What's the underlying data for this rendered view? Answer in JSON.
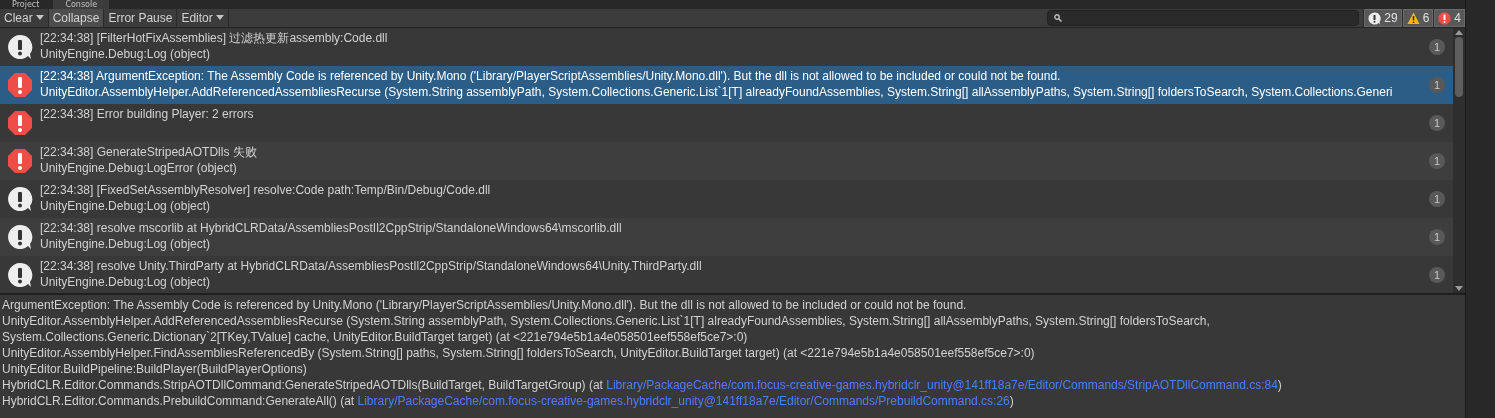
{
  "tabs": [
    {
      "label": "Project",
      "selected": false
    },
    {
      "label": "Console",
      "selected": true
    }
  ],
  "toolbar": {
    "buttons": [
      {
        "label": "Clear",
        "dropdown": true,
        "on": false
      },
      {
        "label": "Collapse",
        "dropdown": false,
        "on": true
      },
      {
        "label": "Error Pause",
        "dropdown": false,
        "on": false
      },
      {
        "label": "Editor",
        "dropdown": true,
        "on": false
      }
    ],
    "counters": [
      {
        "kind": "log",
        "count": "29",
        "selected": true
      },
      {
        "kind": "warning",
        "count": "6",
        "selected": true
      },
      {
        "kind": "error",
        "count": "4",
        "selected": true
      }
    ]
  },
  "entries": [
    {
      "kind": "log",
      "selected": false,
      "message": "[22:34:38] [FilterHotFixAssemblies] 过滤热更新assembly:Code.dll",
      "trace": "UnityEngine.Debug:Log (object)",
      "count": "1"
    },
    {
      "kind": "error",
      "selected": true,
      "message": "[22:34:38] ArgumentException: The Assembly Code is referenced by Unity.Mono ('Library/PlayerScriptAssemblies/Unity.Mono.dll'). But the dll is not allowed to be included or could not be found.",
      "trace": "UnityEditor.AssemblyHelper.AddReferencedAssembliesRecurse (System.String assemblyPath, System.Collections.Generic.List`1[T] alreadyFoundAssemblies, System.String[] allAssemblyPaths, System.String[] foldersToSearch, System.Collections.Generi",
      "count": "1"
    },
    {
      "kind": "error",
      "selected": false,
      "message": "[22:34:38] Error building Player: 2 errors",
      "count": "1"
    },
    {
      "kind": "error",
      "selected": false,
      "message": "[22:34:38] GenerateStripedAOTDlls 失败",
      "trace": "UnityEngine.Debug:LogError (object)",
      "count": "1"
    },
    {
      "kind": "log",
      "selected": false,
      "message": "[22:34:38] [FixedSetAssemblyResolver] resolve:Code path:Temp/Bin/Debug/Code.dll",
      "trace": "UnityEngine.Debug:Log (object)",
      "count": "1"
    },
    {
      "kind": "log",
      "selected": false,
      "message": "[22:34:38] resolve mscorlib at HybridCLRData/AssembliesPostIl2CppStrip/StandaloneWindows64\\mscorlib.dll",
      "trace": "UnityEngine.Debug:Log (object)",
      "count": "1"
    },
    {
      "kind": "log",
      "selected": false,
      "message": "[22:34:38] resolve Unity.ThirdParty at HybridCLRData/AssembliesPostIl2CppStrip/StandaloneWindows64\\Unity.ThirdParty.dll",
      "trace": "UnityEngine.Debug:Log (object)",
      "count": "1"
    }
  ],
  "details": [
    {
      "text": "ArgumentException: The Assembly Code is referenced by Unity.Mono ('Library/PlayerScriptAssemblies/Unity.Mono.dll'). But the dll is not allowed to be included or could not be found."
    },
    {
      "text": "UnityEditor.AssemblyHelper.AddReferencedAssembliesRecurse (System.String assemblyPath, System.Collections.Generic.List`1[T] alreadyFoundAssemblies, System.String[] allAssemblyPaths, System.String[] foldersToSearch,"
    },
    {
      "text": "System.Collections.Generic.Dictionary`2[TKey,TValue] cache, UnityEditor.BuildTarget target) (at <221e794e5b1a4e058501eef558ef5ce7>:0)"
    },
    {
      "text": "UnityEditor.AssemblyHelper.FindAssembliesReferencedBy (System.String[] paths, System.String[] foldersToSearch, UnityEditor.BuildTarget target) (at <221e794e5b1a4e058501eef558ef5ce7>:0)"
    },
    {
      "text": "UnityEditor.BuildPipeline:BuildPlayer(BuildPlayerOptions)"
    },
    {
      "text": "HybridCLR.Editor.Commands.StripAOTDllCommand:GenerateStripedAOTDlls(BuildTarget, BuildTargetGroup) (at",
      "link": "Library/PackageCache/com.focus-creative-games.hybridclr_unity@141ff18a7e/Editor/Commands/StripAOTDllCommand.cs:84",
      "after": ")"
    },
    {
      "text": "HybridCLR.Editor.Commands.PrebuildCommand:GenerateAll() (at",
      "link": "Library/PackageCache/com.focus-creative-games.hybridclr_unity@141ff18a7e/Editor/Commands/PrebuildCommand.cs:26",
      "after": ")"
    }
  ]
}
